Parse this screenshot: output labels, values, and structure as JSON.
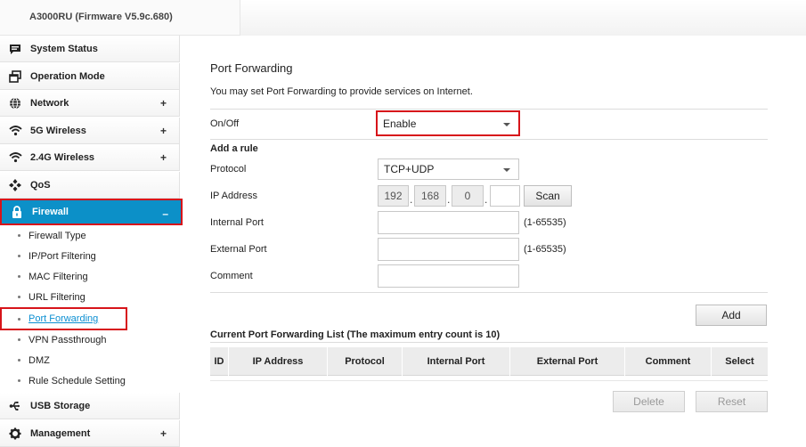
{
  "header": {
    "title": "A3000RU (Firmware V5.9c.680)"
  },
  "sidebar": {
    "items": [
      {
        "label": "System Status",
        "icon": "message-icon",
        "plus": ""
      },
      {
        "label": "Operation Mode",
        "icon": "window-icon",
        "plus": ""
      },
      {
        "label": "Network",
        "icon": "globe-icon",
        "plus": "+"
      },
      {
        "label": "5G Wireless",
        "icon": "wifi-icon",
        "plus": "+"
      },
      {
        "label": "2.4G Wireless",
        "icon": "wifi-icon",
        "plus": "+"
      },
      {
        "label": "QoS",
        "icon": "qos-icon",
        "plus": ""
      },
      {
        "label": "Firewall",
        "icon": "lock-icon",
        "plus": "–"
      },
      {
        "label": "USB Storage",
        "icon": "usb-icon",
        "plus": ""
      },
      {
        "label": "Management",
        "icon": "gear-icon",
        "plus": "+"
      }
    ],
    "firewall_sub": [
      "Firewall Type",
      "IP/Port Filtering",
      "MAC Filtering",
      "URL Filtering",
      "Port Forwarding",
      "VPN Passthrough",
      "DMZ",
      "Rule Schedule Setting"
    ]
  },
  "main": {
    "title": "Port Forwarding",
    "description": "You may set Port Forwarding to provide services on Internet.",
    "onoff_label": "On/Off",
    "onoff_value": "Enable",
    "add_rule_label": "Add a rule",
    "protocol_label": "Protocol",
    "protocol_value": "TCP+UDP",
    "ip_label": "IP Address",
    "ip_octets": [
      "192",
      "168",
      "0",
      ""
    ],
    "scan_label": "Scan",
    "internal_port_label": "Internal Port",
    "external_port_label": "External Port",
    "port_range": "(1-65535)",
    "comment_label": "Comment",
    "add_button": "Add",
    "list_title": "Current Port Forwarding List (The maximum entry count is 10)",
    "columns": [
      "ID",
      "IP Address",
      "Protocol",
      "Internal Port",
      "External Port",
      "Comment",
      "Select"
    ],
    "delete_button": "Delete",
    "reset_button": "Reset"
  },
  "colors": {
    "active_menu": "#0c90c8",
    "highlight": "#d7141a",
    "link": "#0c8fd2"
  }
}
